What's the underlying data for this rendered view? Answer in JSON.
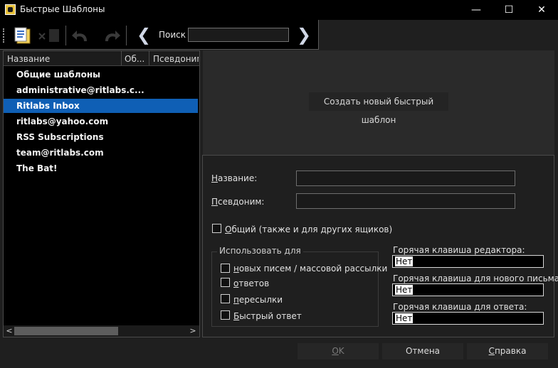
{
  "window": {
    "title": "Быстрые Шаблоны",
    "minimize_glyph": "—",
    "maximize_glyph": "☐",
    "close_glyph": "✕"
  },
  "toolbar": {
    "search_label": "Поиск",
    "search_value": "",
    "prev_glyph": "❮",
    "next_glyph": "❯"
  },
  "list": {
    "columns": [
      "Название",
      "Об...",
      "Псевдоним"
    ],
    "items": [
      {
        "label": "Общие шаблоны",
        "selected": false
      },
      {
        "label": "administrative@ritlabs.c...",
        "selected": false
      },
      {
        "label": "Ritlabs Inbox",
        "selected": true
      },
      {
        "label": "ritlabs@yahoo.com",
        "selected": false
      },
      {
        "label": "RSS Subscriptions",
        "selected": false
      },
      {
        "label": "team@ritlabs.com",
        "selected": false
      },
      {
        "label": "The Bat!",
        "selected": false
      }
    ],
    "scroll_left_glyph": "<",
    "scroll_right_glyph": ">"
  },
  "create_button": "Создать новый быстрый шаблон",
  "form": {
    "name_label_u": "Н",
    "name_label_rest": "азвание:",
    "alias_label_u": "П",
    "alias_label_rest": "севдоним:",
    "common_label_u": "О",
    "common_label_rest": "бщий (также и для других ящиков)",
    "use_for_title": "Использовать для",
    "use_for": [
      {
        "u": "н",
        "rest": "овых писем / массовой рассылки"
      },
      {
        "u": "о",
        "rest": "тветов"
      },
      {
        "u": "п",
        "rest": "ересылки"
      },
      {
        "u": "Б",
        "rest": "ыстрый ответ"
      }
    ],
    "hotkey_editor_label": "Горячая клавиша редактора:",
    "hotkey_editor_value": "Нет",
    "hotkey_new_label": "Горячая клавиша для нового письма:",
    "hotkey_new_value": "Нет",
    "hotkey_reply_label": "Горячая клавиша для ответа:",
    "hotkey_reply_value": "Нет"
  },
  "buttons": {
    "ok_u": "O",
    "ok_rest": "K",
    "cancel": "Отмена",
    "help_u": "С",
    "help_rest": "правка"
  },
  "colors": {
    "selection": "#0f5fb5",
    "background": "#1f1f1f"
  }
}
